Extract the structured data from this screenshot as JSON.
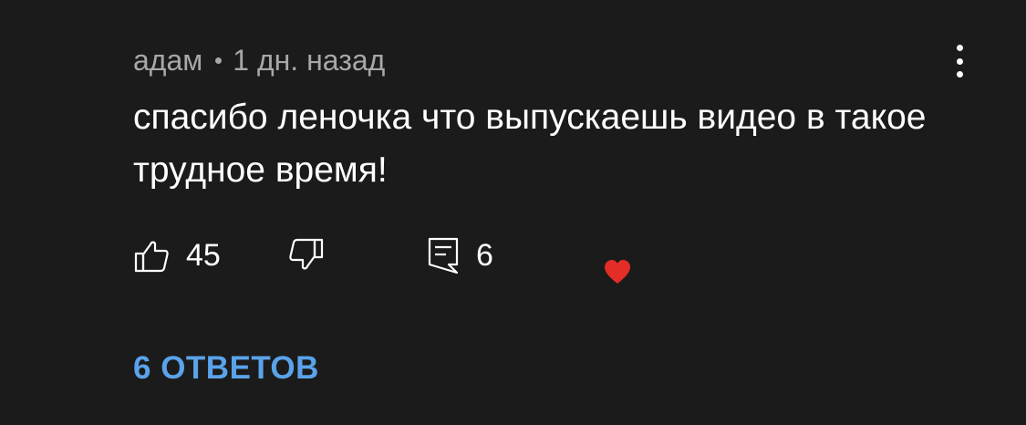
{
  "comment": {
    "author": "адам",
    "time": "1 дн. назад",
    "text": "спасибо леночка что выпускаешь видео в такое трудное время!",
    "likes": "45",
    "replies_count": "6",
    "replies_button": "6 ОТВЕТОВ",
    "hearted_by_creator": true
  },
  "icons": {
    "like": "thumbs-up-icon",
    "dislike": "thumbs-down-icon",
    "reply": "comment-icon",
    "heart": "heart-icon",
    "more": "more-vertical-icon"
  },
  "colors": {
    "background": "#1b1b1b",
    "meta_text": "#a8a8a8",
    "text": "#ffffff",
    "link": "#5aa3ea",
    "heart": "#e52d27"
  }
}
